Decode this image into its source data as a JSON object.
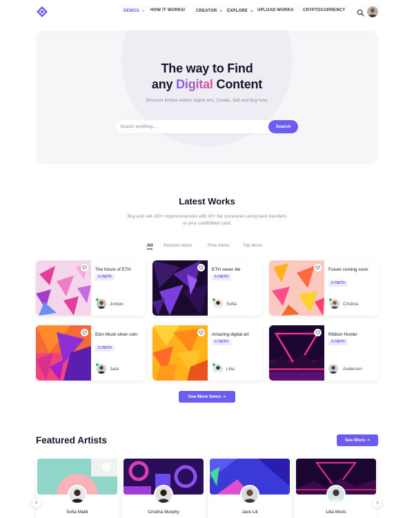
{
  "nav": {
    "menu": [
      {
        "label": "DEMOS",
        "active": true,
        "dropdown": true
      },
      {
        "label": "HOW IT WORKS!",
        "active": false,
        "dropdown": false
      },
      {
        "label": "CREATOR",
        "active": false,
        "dropdown": true
      },
      {
        "label": "EXPLORE",
        "active": false,
        "dropdown": true
      },
      {
        "label": "UPLOAD WORKS",
        "active": false,
        "dropdown": false
      },
      {
        "label": "CRYPTOCURRENCY",
        "active": false,
        "dropdown": false
      }
    ],
    "search_icon": "search-icon",
    "avatar_icon": "user-avatar"
  },
  "hero": {
    "title_line1": "The way to Find",
    "title_pre": "any ",
    "title_highlight": "Digital",
    "title_post": " Content",
    "subtitle": "Discover limited-edition digital arts. Create, Sell and Buy now.",
    "search_placeholder": "Search anything...",
    "search_button": "Search"
  },
  "latest": {
    "title": "Latest Works",
    "subtitle_line1": "Buy and sell 100+ cryptocurrencies with 20+ fiat currencies using bank transfers",
    "subtitle_line2": "or your credit/debit card.",
    "filters": [
      "All",
      "Recents Items",
      "Free Items",
      "Top Items"
    ],
    "active_filter": "All",
    "items": [
      {
        "title": "The future of ETH",
        "price": "0.75ETH",
        "owner": "Jordan"
      },
      {
        "title": "ETH never die",
        "price": "0.75ETH",
        "owner": "Sofia"
      },
      {
        "title": "Future coming soon",
        "price": "0.75ETH",
        "owner": "Cristina"
      },
      {
        "title": "Elon Musk silver coin",
        "price": "0.75ETH",
        "owner": "Jack"
      },
      {
        "title": "Amazing digital art",
        "price": "0.75ETH",
        "owner": "Lilia"
      },
      {
        "title": "Ribbon Hunter",
        "price": "0.75ETH",
        "owner": "Anderson"
      }
    ],
    "more_button": "See More Items"
  },
  "featured": {
    "title": "Featured Artists",
    "more_button": "See More",
    "artists": [
      "Sofia Malik",
      "Cristina Murphy",
      "Jack Lili",
      "Lilia Moris"
    ]
  },
  "colors": {
    "accent": "#6c5cf2",
    "hero_bg": "#f6f6f9",
    "price_bg": "#ececfb",
    "verified": "#22c55e"
  }
}
